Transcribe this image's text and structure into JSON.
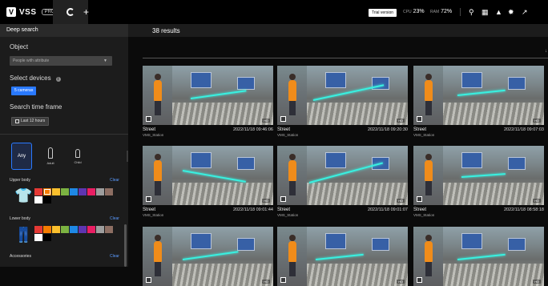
{
  "topbar": {
    "logo_text": "VSS",
    "pro_badge": "PRO",
    "trial_label": "Trial version",
    "cpu_label": "CPU",
    "cpu_value": "23%",
    "ram_label": "RAM",
    "ram_value": "72%",
    "icons": [
      "search-icon",
      "grid-icon",
      "bell-icon",
      "gear-icon",
      "pin-icon"
    ]
  },
  "sidebar": {
    "title": "Deep search",
    "object_label": "Object",
    "object_select": "People with attribute",
    "devices_label": "Select devices",
    "devices_button": "5 cameras",
    "timeframe_label": "Search time frame",
    "timeframe_button": "Last 12 hours",
    "age_any": "Any",
    "age_adult": "Adult",
    "age_child": "Child",
    "upper_body_label": "Upper body",
    "lower_body_label": "Lower body",
    "accessories_label": "Accessories",
    "clear_label": "Clear",
    "upper_colors": [
      "#e53935",
      "#f57c00",
      "#fbc02d",
      "#7cb342",
      "#1e88e5",
      "#5e35b1",
      "#e91e63",
      "#9e9e9e",
      "#8d6e63",
      "#ffffff",
      "#000000"
    ],
    "lower_colors": [
      "#e53935",
      "#f57c00",
      "#fbc02d",
      "#7cb342",
      "#1e88e5",
      "#5e35b1",
      "#e91e63",
      "#9e9e9e",
      "#8d6e63",
      "#ffffff",
      "#000000"
    ],
    "upper_selected_index": 1
  },
  "main": {
    "results_title": "38 results",
    "results": [
      {
        "name": "Street",
        "device": "VMS_Station",
        "time": "2022/11/18 09:46:06"
      },
      {
        "name": "Street",
        "device": "VMS_Station",
        "time": "2022/11/18 09:20:30"
      },
      {
        "name": "Street",
        "device": "VMS_Station",
        "time": "2022/11/18 09:07:03"
      },
      {
        "name": "Street",
        "device": "VMS_Station",
        "time": "2022/11/18 09:01:44"
      },
      {
        "name": "Street",
        "device": "VMS_Station",
        "time": "2022/11/18 09:01:07"
      },
      {
        "name": "Street",
        "device": "VMS_Station",
        "time": "2022/11/18 08:58:18"
      },
      {
        "name": "",
        "device": "",
        "time": ""
      },
      {
        "name": "",
        "device": "",
        "time": ""
      },
      {
        "name": "",
        "device": "",
        "time": ""
      }
    ]
  }
}
